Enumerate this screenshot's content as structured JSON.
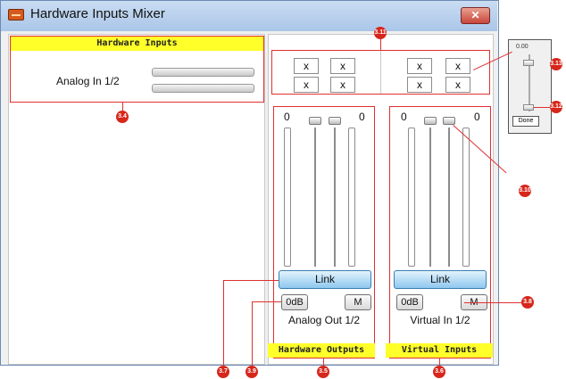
{
  "window": {
    "title": "Hardware Inputs Mixer",
    "close_glyph": "✕"
  },
  "hardware_inputs": {
    "header": "Hardware Inputs",
    "channel_label": "Analog In 1/2"
  },
  "matrix": {
    "cells": [
      "x",
      "x",
      "x",
      "x",
      "x",
      "x",
      "x",
      "x"
    ]
  },
  "channels": [
    {
      "gain_left": "0",
      "gain_right": "0",
      "link_label": "Link",
      "zero_db_label": "0dB",
      "mute_label": "M",
      "name": "Analog Out 1/2",
      "section_label": "Hardware Outputs"
    },
    {
      "gain_left": "0",
      "gain_right": "0",
      "link_label": "Link",
      "zero_db_label": "0dB",
      "mute_label": "M",
      "name": "Virtual In 1/2",
      "section_label": "Virtual Inputs"
    }
  ],
  "popup": {
    "value": "0.00",
    "done_label": "Done"
  },
  "callouts": [
    "3.4",
    "3.5",
    "3.6",
    "3.7",
    "3.8",
    "3.9",
    "3.10",
    "3.11",
    "3.12",
    "3.13"
  ],
  "colors": {
    "accent_red": "#d7261b",
    "highlight_yellow": "#ffff2a",
    "link_blue": "#8fc7ee"
  }
}
